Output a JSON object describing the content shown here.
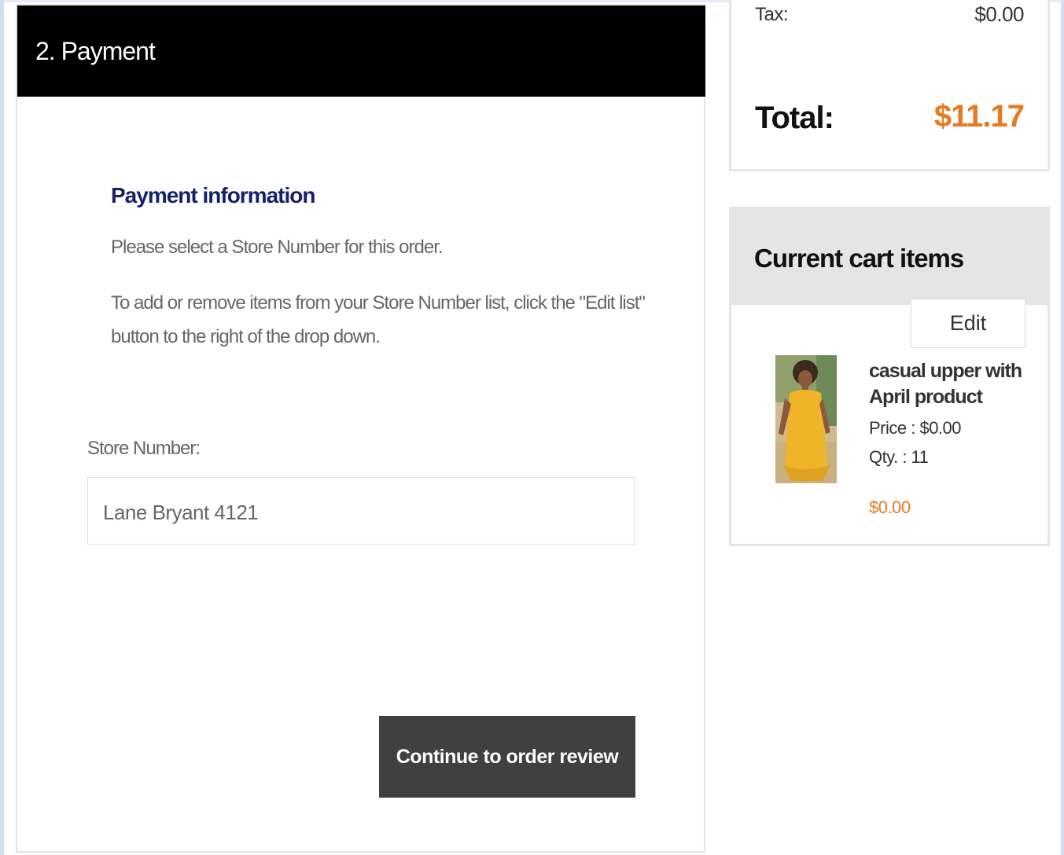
{
  "payment": {
    "header_title": "2. Payment",
    "info_title": "Payment information",
    "instruction_1": "Please select a Store Number for this order.",
    "instruction_2": "To add or remove items from your Store Number list, click the \"Edit list\" button to the right of the drop down.",
    "store_label": "Store Number:",
    "store_value": "Lane Bryant 4121",
    "continue_label": "Continue to order review"
  },
  "totals": {
    "tax_label": "Tax:",
    "tax_value": "$0.00",
    "total_label": "Total:",
    "total_value": "$11.17",
    "total_color": "#e87a22"
  },
  "cart": {
    "title": "Current cart items",
    "edit_label": "Edit",
    "items": [
      {
        "name": "casual upper with April product",
        "price": "Price :  $0.00",
        "qty": "Qty. :  11",
        "line_total": "$0.00",
        "image_icon": "product-photo"
      }
    ]
  },
  "colors": {
    "accent_orange": "#e87a22",
    "heading_navy": "#15206b",
    "header_black": "#000000",
    "button_dark": "#404040"
  }
}
